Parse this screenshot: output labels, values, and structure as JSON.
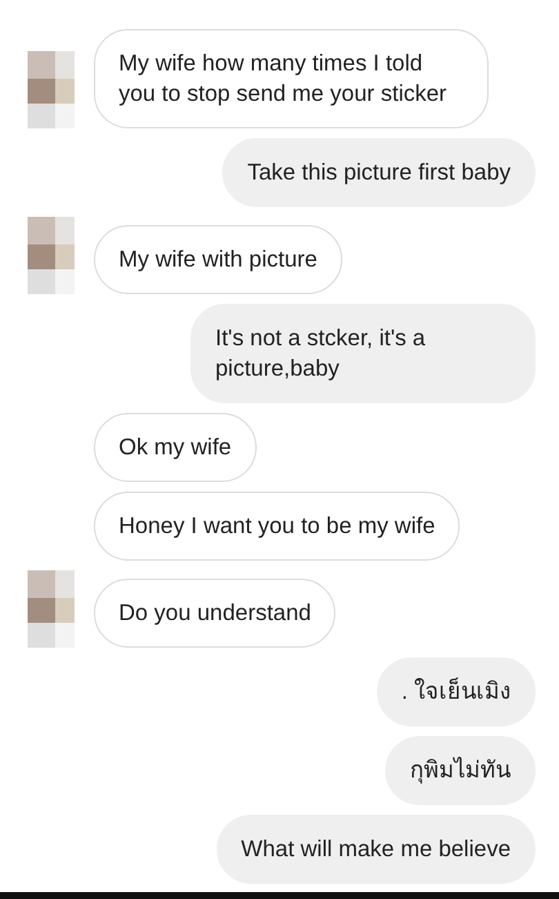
{
  "messages": [
    {
      "kind": "in",
      "text": "My wife how many times I told you to stop send me your sticker",
      "avatar": true
    },
    {
      "kind": "out",
      "text": "Take this picture first baby"
    },
    {
      "kind": "in",
      "text": "My wife with picture",
      "avatar": true
    },
    {
      "kind": "out",
      "text": "It's not a stcker, it's a picture,baby"
    },
    {
      "kind": "in",
      "text": "Ok my wife"
    },
    {
      "kind": "in",
      "text": "Honey I want you to be my wife"
    },
    {
      "kind": "in",
      "text": "Do you understand",
      "avatar": true
    },
    {
      "kind": "out",
      "text": ". ใจเย็นเมิง"
    },
    {
      "kind": "out",
      "text": "กุพิมไม่ทัน"
    },
    {
      "kind": "out",
      "text": "What will make me believe"
    }
  ]
}
